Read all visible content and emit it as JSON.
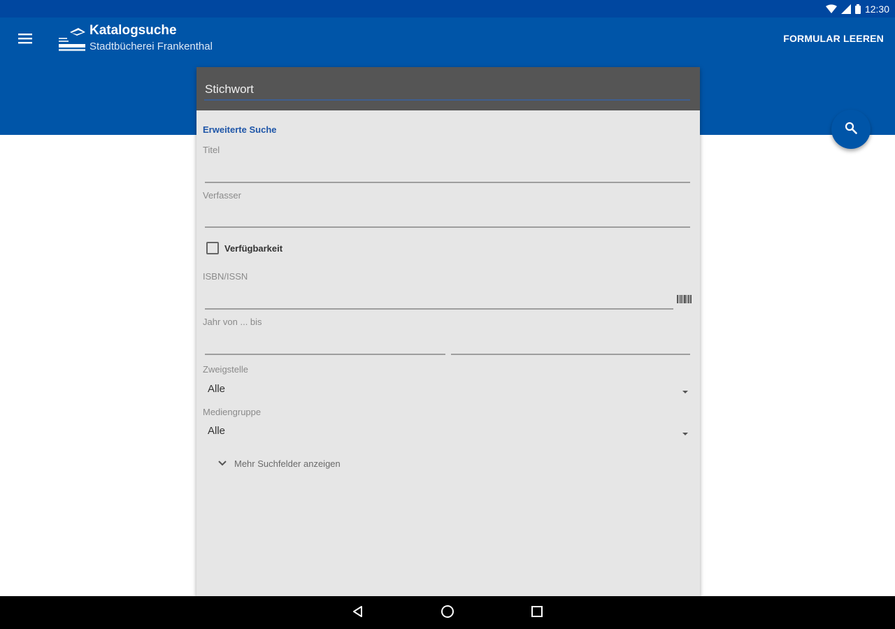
{
  "status_bar": {
    "time": "12:30"
  },
  "app_bar": {
    "title": "Katalogsuche",
    "subtitle": "Stadtbücherei Frankenthal",
    "clear_label": "FORMULAR LEEREN"
  },
  "search": {
    "keyword_placeholder": "Stichwort",
    "advanced_title": "Erweiterte Suche",
    "title_label": "Titel",
    "author_label": "Verfasser",
    "availability_label": "Verfügbarkeit",
    "isbn_label": "ISBN/ISSN",
    "year_label": "Jahr von ... bis",
    "branch_label": "Zweigstelle",
    "branch_value": "Alle",
    "media_label": "Mediengruppe",
    "media_value": "Alle",
    "more_fields_label": "Mehr Suchfelder anzeigen"
  },
  "icons": {
    "menu": "menu-icon",
    "search": "search-icon",
    "barcode": "barcode-icon",
    "back": "back-icon",
    "home": "home-icon",
    "recents": "recents-icon"
  },
  "colors": {
    "primary": "#0055a8",
    "status_bar": "#0047a0",
    "accent_text": "#1f56a8",
    "card_background": "#e6e6e6",
    "keyword_bar": "#555555"
  }
}
